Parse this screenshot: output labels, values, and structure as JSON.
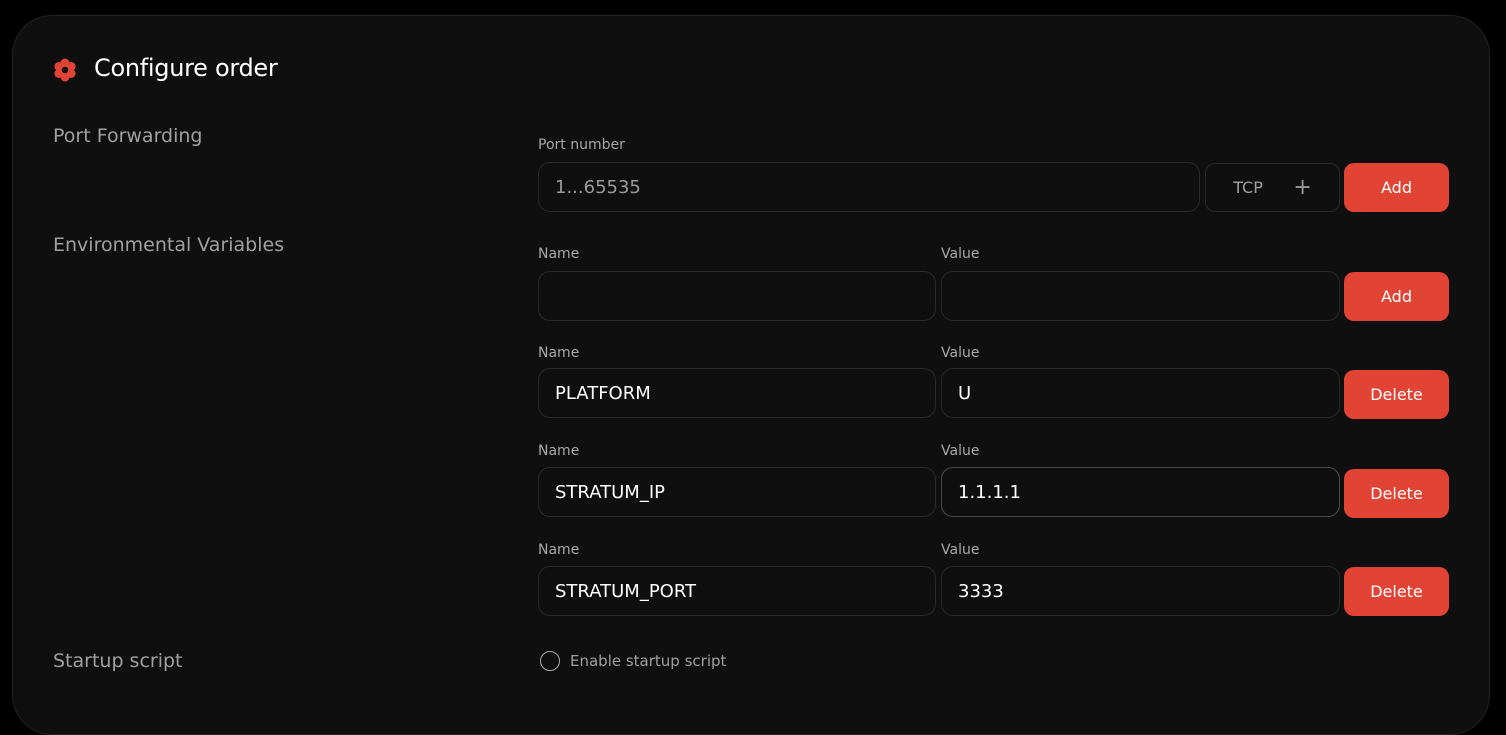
{
  "header": {
    "title": "Configure order",
    "icon": "gear-icon",
    "accent": "#e14434"
  },
  "sections": {
    "port_forwarding": "Port Forwarding",
    "env_vars": "Environmental Variables",
    "startup": "Startup script"
  },
  "port": {
    "label": "Port number",
    "placeholder": "1...65535",
    "value": "",
    "protocol": "TCP",
    "protocol_icon": "plus-icon",
    "add_label": "Add"
  },
  "env": {
    "new": {
      "name_label": "Name",
      "value_label": "Value",
      "name": "",
      "value": "",
      "add_label": "Add"
    },
    "rows": [
      {
        "name_label": "Name",
        "value_label": "Value",
        "name": "PLATFORM",
        "value": "U",
        "delete_label": "Delete"
      },
      {
        "name_label": "Name",
        "value_label": "Value",
        "name": "STRATUM_IP",
        "value": "1.1.1.1",
        "delete_label": "Delete"
      },
      {
        "name_label": "Name",
        "value_label": "Value",
        "name": "STRATUM_PORT",
        "value": "3333",
        "delete_label": "Delete"
      }
    ]
  },
  "startup": {
    "checkbox_label": "Enable startup script",
    "checked": false
  }
}
